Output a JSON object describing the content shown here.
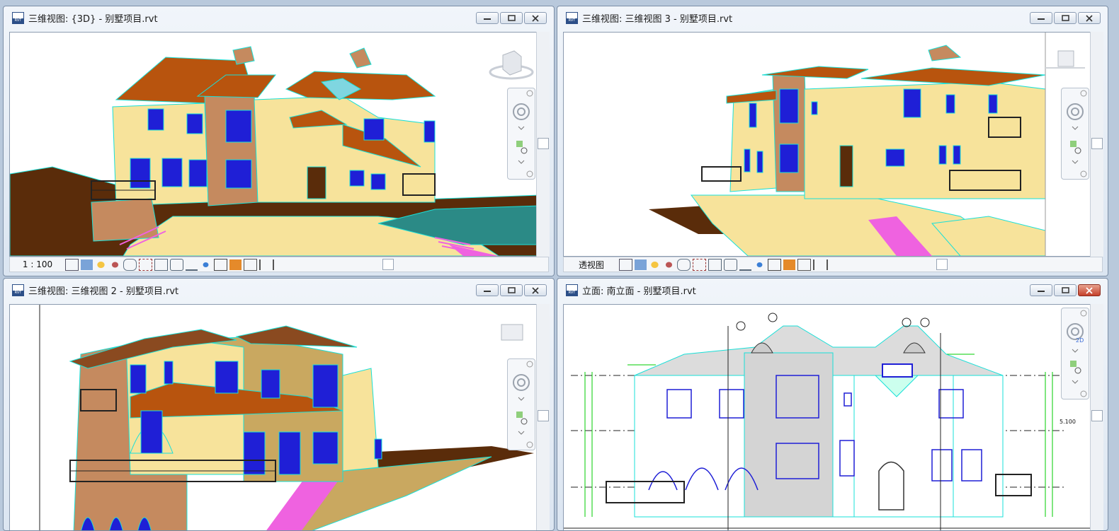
{
  "windows": [
    {
      "title": "三维视图: {3D} - 别墅项目.rvt",
      "status": "1 : 100"
    },
    {
      "title": "三维视图: 三维视图 3 - 别墅项目.rvt",
      "status": "透视图"
    },
    {
      "title": "三维视图: 三维视图 2 - 别墅项目.rvt",
      "status": ""
    },
    {
      "title": "立面: 南立面 - 别墅项目.rvt",
      "status": ""
    }
  ],
  "elevation_labels": {
    "right_level_1": "5.100",
    "nav_2d": "2D"
  },
  "icons": {
    "app": "revit-file-icon",
    "minimize": "minimize-icon",
    "maximize": "maximize-icon",
    "close": "close-icon",
    "steering_wheel": "steering-wheel-icon",
    "zoom": "zoom-icon",
    "view_cube": "view-cube-icon"
  },
  "colors": {
    "roof": "#b8540e",
    "wall": "#f7e39b",
    "stone": "#c58a5f",
    "window": "#1f1fd6",
    "edge": "#19e0d8",
    "ground": "#5a2c0a",
    "stairs": "#ef62e0",
    "dim_green": "#00cc00"
  }
}
